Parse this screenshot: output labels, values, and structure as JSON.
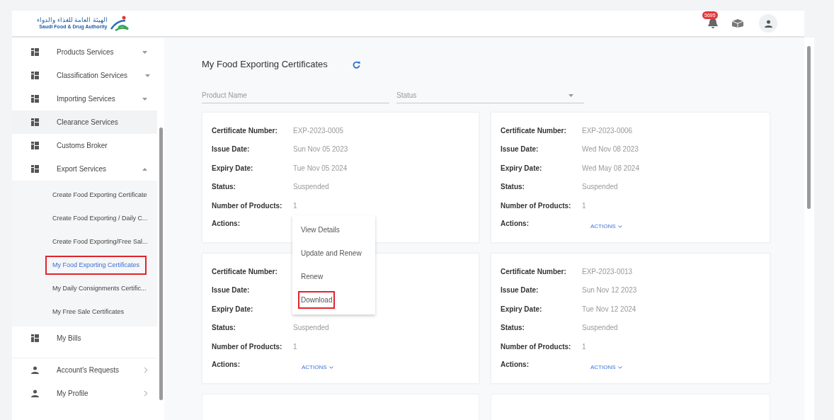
{
  "header": {
    "logo_arabic": "الهيئة العامة للغذاء والدواء",
    "logo_english": "Saudi Food & Drug Authority",
    "notification_count": "5695"
  },
  "sidebar": {
    "items": [
      {
        "kind": "section",
        "label": "Products Services",
        "expanded": false,
        "hovered": false
      },
      {
        "kind": "section",
        "label": "Classification Services",
        "expanded": false,
        "hovered": false
      },
      {
        "kind": "section",
        "label": "Importing Services",
        "expanded": false,
        "hovered": false
      },
      {
        "kind": "plain",
        "label": "Clearance Services",
        "hovered": true
      },
      {
        "kind": "plain",
        "label": "Customs Broker",
        "hovered": false
      },
      {
        "kind": "section",
        "label": "Export Services",
        "expanded": true,
        "hovered": false,
        "children": [
          {
            "label": "Create Food Exporting Certificate",
            "selected": false,
            "outlined": false
          },
          {
            "label": "Create Food Exporting / Daily C...",
            "selected": false,
            "outlined": false
          },
          {
            "label": "Create Food Exporting/Free Sal...",
            "selected": false,
            "outlined": false
          },
          {
            "label": "My Food Exporting Certificates",
            "selected": true,
            "outlined": true
          },
          {
            "label": "My Daily Consignments Certific...",
            "selected": false,
            "outlined": false
          },
          {
            "label": "My Free Sale Certificates",
            "selected": false,
            "outlined": false
          }
        ]
      },
      {
        "kind": "plain",
        "label": "My Bills",
        "hovered": false
      },
      {
        "kind": "account",
        "label": "Account's Requests",
        "hovered": false
      },
      {
        "kind": "account",
        "label": "My Profile",
        "hovered": false
      }
    ]
  },
  "page": {
    "title": "My Food Exporting Certificates"
  },
  "filters": {
    "product_name": {
      "placeholder": "Product Name"
    },
    "status": {
      "placeholder": "Status"
    }
  },
  "cards": [
    {
      "fields": [
        {
          "label": "Certificate Number:",
          "value": "EXP-2023-0005"
        },
        {
          "label": "Issue Date:",
          "value": "Sun Nov 05 2023"
        },
        {
          "label": "Expiry Date:",
          "value": "Tue Nov 05 2024"
        },
        {
          "label": "Status:",
          "value": "Suspended"
        },
        {
          "label": "Number of Products:",
          "value": "1"
        }
      ],
      "actions_label": "Actions:"
    },
    {
      "fields": [
        {
          "label": "Certificate Number:",
          "value": "EXP-2023-0006"
        },
        {
          "label": "Issue Date:",
          "value": "Wed Nov 08 2023"
        },
        {
          "label": "Expiry Date:",
          "value": "Wed May 08 2024"
        },
        {
          "label": "Status:",
          "value": "Suspended"
        },
        {
          "label": "Number of Products:",
          "value": "1"
        }
      ],
      "actions_label": "Actions:",
      "actions_button": "ACTIONS"
    },
    {
      "fields": [
        {
          "label": "Certificate Number:"
        },
        {
          "label": "Issue Date:"
        },
        {
          "label": "Expiry Date:"
        },
        {
          "label": "Status:",
          "value": "Suspended"
        },
        {
          "label": "Number of Products:",
          "value": "1"
        }
      ],
      "actions_label": "Actions:",
      "actions_button": "ACTIONS"
    },
    {
      "fields": [
        {
          "label": "Certificate Number:",
          "value": "EXP-2023-0013"
        },
        {
          "label": "Issue Date:",
          "value": "Sun Nov 12 2023"
        },
        {
          "label": "Expiry Date:",
          "value": "Tue Nov 12 2024"
        },
        {
          "label": "Status:",
          "value": "Suspended"
        },
        {
          "label": "Number of Products:",
          "value": "1"
        }
      ],
      "actions_label": "Actions:",
      "actions_button": "ACTIONS"
    }
  ],
  "action_menu": {
    "items": [
      {
        "label": "View Details",
        "outlined": false
      },
      {
        "label": "Update and Renew",
        "outlined": false
      },
      {
        "label": "Renew",
        "outlined": false
      },
      {
        "label": "Download",
        "outlined": true
      }
    ]
  }
}
